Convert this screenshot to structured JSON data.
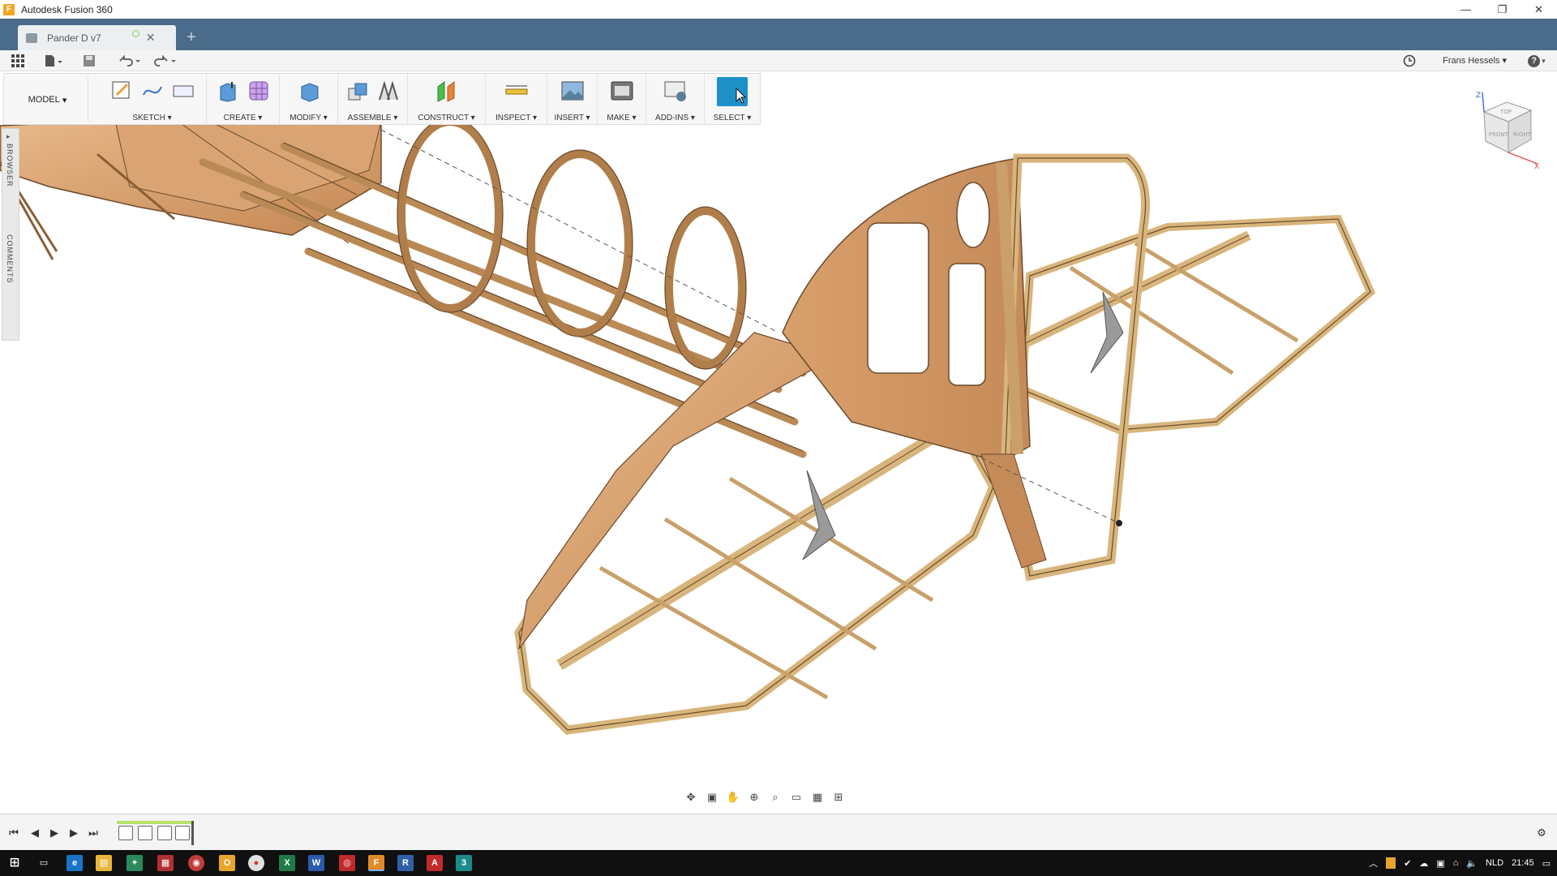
{
  "window": {
    "title": "Autodesk Fusion 360",
    "app_logo": "F",
    "minimize": "—",
    "restore": "❐",
    "close": "✕"
  },
  "document_tab": {
    "name": "Pander D v7",
    "close": "✕",
    "new_tab": "+"
  },
  "quick_access": {
    "user_name": "Frans Hessels",
    "user_dropdown": "▾",
    "help": "?"
  },
  "ribbon": {
    "workspace": "MODEL",
    "groups": [
      {
        "label": "SKETCH",
        "icons": [
          "sketch-create-icon",
          "spline-icon",
          "rectangle-icon"
        ]
      },
      {
        "label": "CREATE",
        "icons": [
          "extrude-icon",
          "form-icon"
        ]
      },
      {
        "label": "MODIFY",
        "icons": [
          "press-pull-icon"
        ]
      },
      {
        "label": "ASSEMBLE",
        "icons": [
          "new-component-icon",
          "joint-icon"
        ]
      },
      {
        "label": "CONSTRUCT",
        "icons": [
          "offset-plane-icon"
        ]
      },
      {
        "label": "INSPECT",
        "icons": [
          "measure-icon"
        ]
      },
      {
        "label": "INSERT",
        "icons": [
          "insert-image-icon"
        ]
      },
      {
        "label": "MAKE",
        "icons": [
          "3d-print-icon"
        ]
      },
      {
        "label": "ADD-INS",
        "icons": [
          "scripts-icon"
        ]
      },
      {
        "label": "SELECT",
        "icons": [
          "select-icon"
        ]
      }
    ]
  },
  "side_panel": {
    "browser": "BROWSER",
    "comments": "COMMENTS"
  },
  "viewcube": {
    "top": "TOP",
    "front": "FRONT",
    "right": "RIGHT",
    "axis_x": "X",
    "axis_z": "Z"
  },
  "taskbar": {
    "language": "NLD",
    "clock": "21:45"
  },
  "colors": {
    "tabbar": "#4a6b8a",
    "wood_light": "#e4c28e",
    "wood_dark": "#c9905b",
    "wood_edge": "#6b4a2b",
    "accent_select": "#1e90c8"
  }
}
